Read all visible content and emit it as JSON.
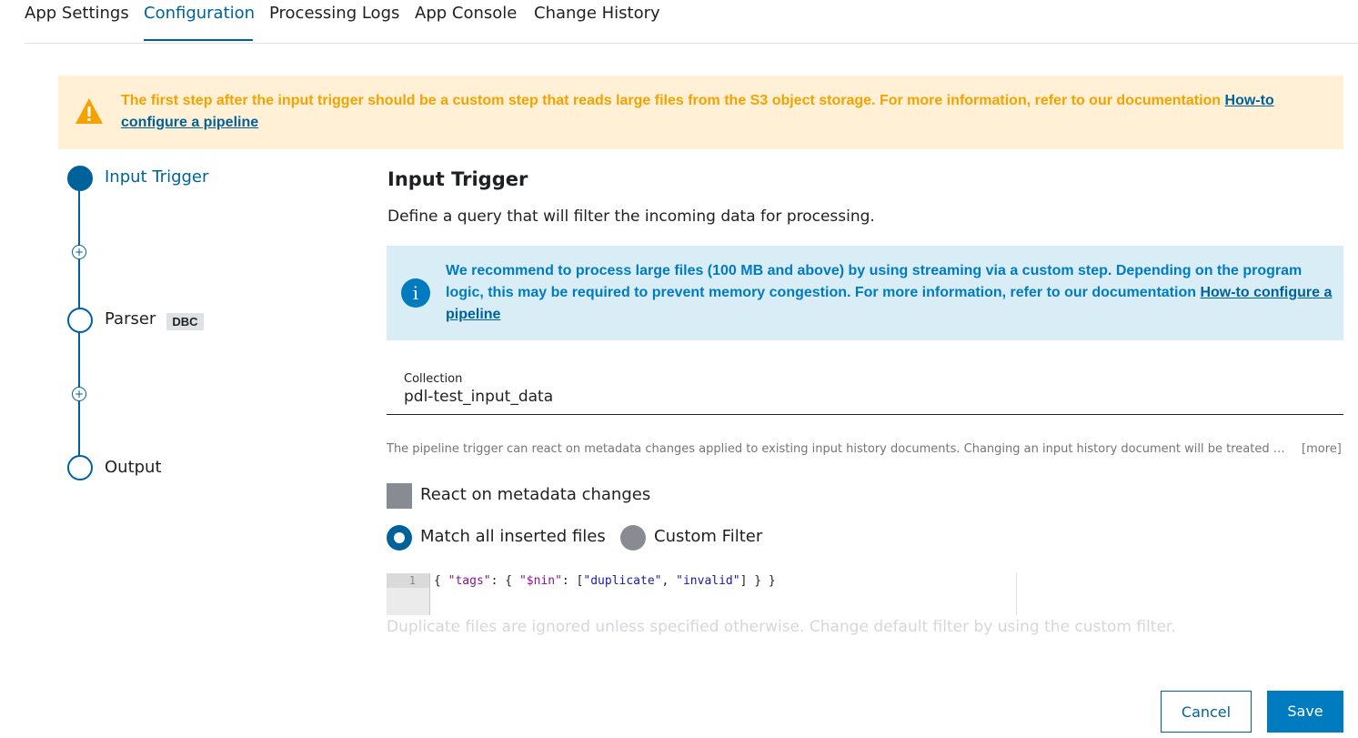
{
  "tabs": [
    {
      "label": "App Settings"
    },
    {
      "label": "Configuration"
    },
    {
      "label": "Processing Logs"
    },
    {
      "label": "App Console"
    },
    {
      "label": "Change History"
    }
  ],
  "active_tab": "Configuration",
  "warning": {
    "icon": "warning-icon",
    "text": "The first step after the input trigger should be a custom step that reads large files from the S3 object storage. For more information, refer to our documentation ",
    "link": "How-to configure a pipeline",
    "color": "#f3a200",
    "background": "#fff0d6"
  },
  "steps": [
    {
      "label": "Input Trigger",
      "active": true
    },
    {
      "label": "Parser",
      "badge": "DBC"
    },
    {
      "label": "Output"
    }
  ],
  "main": {
    "title": "Input Trigger",
    "subtitle": "Define a query that will filter the incoming data for processing.",
    "info": {
      "icon": "info-icon",
      "icon_glyph": "i",
      "text": "We recommend to process large files (100 MB and above) by using streaming via a custom step. Depending on the program logic, this may be required to prevent memory congestion. For more information, refer to our documentation ",
      "link": "How-to configure a pipeline"
    },
    "collection": {
      "label": "Collection",
      "value": "pdl-test_input_data"
    },
    "note": "The pipeline trigger can react on metadata changes applied to existing input history documents. Changing an input history document will be treated as a new input and trigger the pipeline.",
    "more": "[more]",
    "checkbox": {
      "label": "React on metadata changes",
      "checked": false
    },
    "radios": [
      {
        "label": "Match all inserted files",
        "selected": true
      },
      {
        "label": "Custom Filter",
        "selected": false
      }
    ],
    "editor": {
      "line_number": "1"
    },
    "hint": "Duplicate files are ignored unless specified otherwise. Change default filter by using the custom filter."
  },
  "buttons": {
    "cancel": "Cancel",
    "save": "Save"
  },
  "colors": {
    "primary": "#00629a",
    "accent": "#007bc0",
    "info_bg": "#d9edf7"
  }
}
